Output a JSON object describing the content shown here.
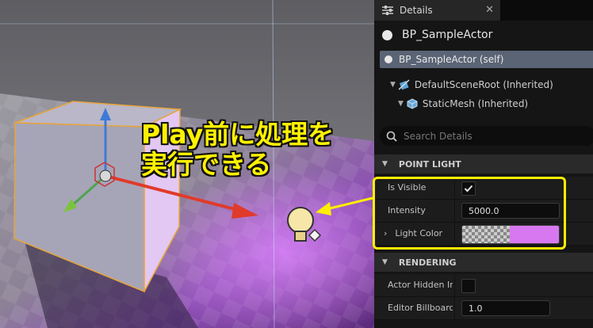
{
  "overlay": {
    "headline_line1": "Play前に処理を",
    "headline_line2": "実行できる",
    "highlight_color": "#ffee00"
  },
  "details": {
    "tab_label": "Details",
    "tab_icon": "sliders-icon",
    "close_glyph": "✕",
    "actor_title": "BP_SampleActor",
    "self_label": "BP_SampleActor (self)",
    "components": [
      {
        "label": "DefaultSceneRoot (Inherited)",
        "icon": "scene-root-icon"
      },
      {
        "label": "StaticMesh (Inherited)",
        "icon": "static-mesh-icon"
      }
    ],
    "search_placeholder": "Search Details",
    "sections": [
      {
        "title": "POINT LIGHT"
      },
      {
        "title": "RENDERING"
      }
    ],
    "point_light": {
      "is_visible_label": "Is Visible",
      "is_visible_checked": true,
      "intensity_label": "Intensity",
      "intensity_value": "5000.0",
      "light_color_label": "Light Color",
      "light_color_hex": "#d878f0"
    },
    "rendering": {
      "actor_hidden_label": "Actor Hidden In",
      "actor_hidden_checked": false,
      "editor_billboard_label": "Editor Billboard",
      "editor_billboard_value": "1.0"
    }
  }
}
